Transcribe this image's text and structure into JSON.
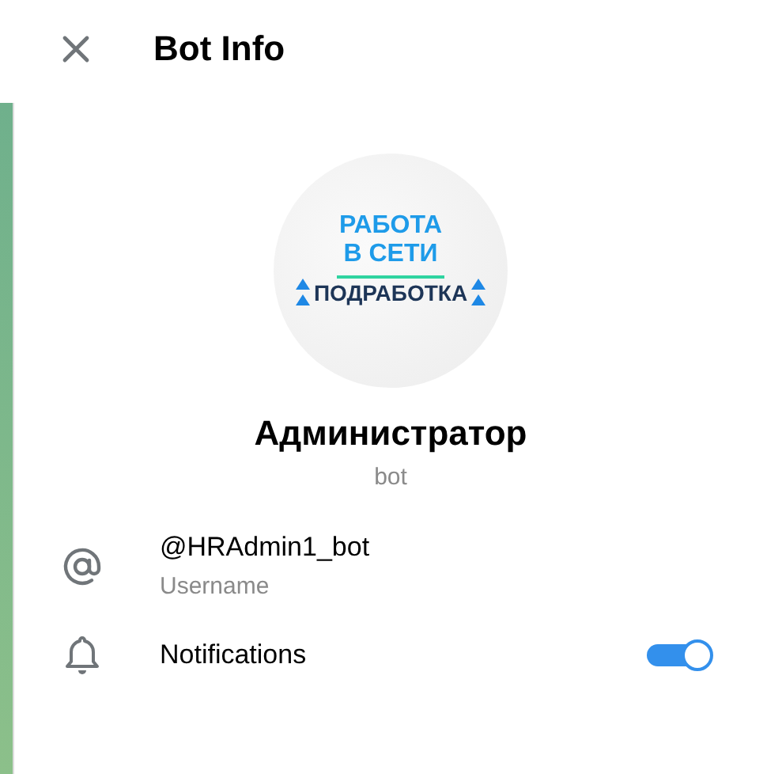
{
  "header": {
    "title": "Bot Info"
  },
  "avatar": {
    "lines": [
      {
        "text": "РАБОТА",
        "kind": "accent"
      },
      {
        "text": "В СЕТИ",
        "kind": "accent"
      },
      {
        "text": "ПОДРАБОТКА",
        "kind": "dark"
      }
    ]
  },
  "profile": {
    "name": "Администратор",
    "status": "bot"
  },
  "rows": [
    {
      "kind": "username",
      "value": "@HRAdmin1_bot",
      "label": "Username"
    },
    {
      "kind": "notifications",
      "value": "Notifications",
      "on": true
    }
  ]
}
